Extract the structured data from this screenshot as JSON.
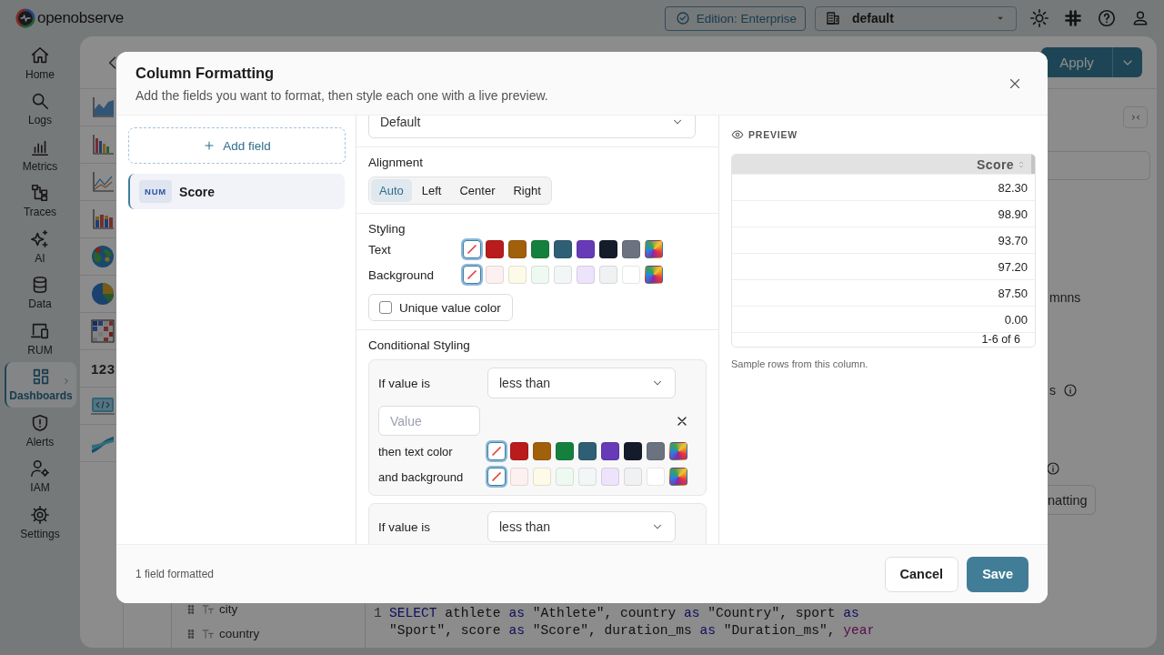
{
  "app": {
    "brand": "openobserve",
    "edition": "Edition: Enterprise",
    "org": "default",
    "nav": [
      {
        "label": "Home",
        "kind": "home",
        "selected": false
      },
      {
        "label": "Logs",
        "kind": "logs",
        "selected": false
      },
      {
        "label": "Metrics",
        "kind": "metrics",
        "selected": false
      },
      {
        "label": "Traces",
        "kind": "traces",
        "selected": false
      },
      {
        "label": "AI",
        "kind": "ai",
        "selected": false
      },
      {
        "label": "Data",
        "kind": "data",
        "selected": false
      },
      {
        "label": "RUM",
        "kind": "rum",
        "selected": false
      },
      {
        "label": "Dashboards",
        "kind": "dashboards",
        "selected": true
      },
      {
        "label": "Alerts",
        "kind": "alerts",
        "selected": false
      },
      {
        "label": "IAM",
        "kind": "iam",
        "selected": false
      },
      {
        "label": "Settings",
        "kind": "settings",
        "selected": false
      }
    ],
    "apply": "Apply",
    "chart_types": [
      {
        "kind": "area"
      },
      {
        "kind": "bar"
      },
      {
        "kind": "line"
      },
      {
        "kind": "stacked"
      },
      {
        "kind": "geomap"
      },
      {
        "kind": "pie"
      },
      {
        "kind": "heatmap"
      },
      {
        "kind": "metric",
        "label": "123"
      },
      {
        "kind": "html"
      },
      {
        "kind": "sankey"
      }
    ],
    "fields": [
      {
        "name": "city"
      },
      {
        "name": "country"
      }
    ],
    "query": {
      "line_number": "1",
      "lines": [
        [
          {
            "kind": "keyword",
            "t": "SELECT"
          },
          {
            "kind": "plain",
            "t": " athlete "
          },
          {
            "kind": "keyword",
            "t": "as"
          },
          {
            "kind": "plain",
            "t": " \"Athlete\", country "
          },
          {
            "kind": "keyword",
            "t": "as"
          },
          {
            "kind": "plain",
            "t": " \"Country\", sport "
          },
          {
            "kind": "keyword",
            "t": "as"
          }
        ],
        [
          {
            "kind": "plain",
            "t": "\"Sport\", score "
          },
          {
            "kind": "keyword",
            "t": "as"
          },
          {
            "kind": "plain",
            "t": " \"Score\", duration_ms "
          },
          {
            "kind": "keyword",
            "t": "as"
          },
          {
            "kind": "plain",
            "t": " \"Duration_ms\", "
          },
          {
            "kind": "function",
            "t": "year"
          }
        ]
      ]
    },
    "side_panel": {
      "label_1": "mnns",
      "label_2": "s",
      "button": "natting"
    }
  },
  "dialog": {
    "title": "Column Formatting",
    "subtitle": "Add the fields you want to format, then style each one with a live preview.",
    "add_field": "Add field",
    "fields": [
      {
        "type": "NUM",
        "name": "Score",
        "selected": true
      }
    ],
    "format_select": "Default",
    "alignment": {
      "label": "Alignment",
      "options": [
        {
          "label": "Auto",
          "selected": true
        },
        {
          "label": "Left",
          "selected": false
        },
        {
          "label": "Center",
          "selected": false
        },
        {
          "label": "Right",
          "selected": false
        }
      ]
    },
    "styling": {
      "label": "Styling",
      "rows": [
        {
          "label": "Text",
          "swatches": [
            {
              "kind": "none",
              "selected": true
            },
            {
              "kind": "solid",
              "color": "#b91c1c",
              "selected": false
            },
            {
              "kind": "solid",
              "color": "#a1600a",
              "selected": false
            },
            {
              "kind": "solid",
              "color": "#15803d",
              "selected": false
            },
            {
              "kind": "solid",
              "color": "#2f5f75",
              "selected": false
            },
            {
              "kind": "solid",
              "color": "#673ab7",
              "selected": false
            },
            {
              "kind": "solid",
              "color": "#141b2b",
              "selected": false
            },
            {
              "kind": "solid",
              "color": "#6b7280",
              "selected": false
            },
            {
              "kind": "custom",
              "selected": false
            }
          ]
        },
        {
          "label": "Background",
          "swatches": [
            {
              "kind": "none",
              "selected": true
            },
            {
              "kind": "solid",
              "color": "#fdf0f0",
              "selected": false
            },
            {
              "kind": "solid",
              "color": "#fdfae8",
              "selected": false
            },
            {
              "kind": "solid",
              "color": "#eefaf1",
              "selected": false
            },
            {
              "kind": "solid",
              "color": "#f2f6f6",
              "selected": false
            },
            {
              "kind": "solid",
              "color": "#ede4fb",
              "selected": false
            },
            {
              "kind": "solid",
              "color": "#f0f1f3",
              "selected": false
            },
            {
              "kind": "solid",
              "color": "#ffffff",
              "selected": false
            },
            {
              "kind": "custom",
              "selected": false
            }
          ]
        }
      ],
      "unique_value_color": {
        "label": "Unique value color",
        "checked": false
      }
    },
    "conditional": {
      "label": "Conditional Styling",
      "rules": [
        {
          "condition_label": "If value is",
          "operator": "less than",
          "value_placeholder": "Value",
          "color_rows": [
            {
              "label": "then text color",
              "swatches": [
                {
                  "kind": "none",
                  "selected": true
                },
                {
                  "kind": "solid",
                  "color": "#b91c1c",
                  "selected": false
                },
                {
                  "kind": "solid",
                  "color": "#a1600a",
                  "selected": false
                },
                {
                  "kind": "solid",
                  "color": "#15803d",
                  "selected": false
                },
                {
                  "kind": "solid",
                  "color": "#2f5f75",
                  "selected": false
                },
                {
                  "kind": "solid",
                  "color": "#673ab7",
                  "selected": false
                },
                {
                  "kind": "solid",
                  "color": "#141b2b",
                  "selected": false
                },
                {
                  "kind": "solid",
                  "color": "#6b7280",
                  "selected": false
                },
                {
                  "kind": "custom",
                  "selected": false
                }
              ]
            },
            {
              "label": "and background",
              "swatches": [
                {
                  "kind": "none",
                  "selected": true
                },
                {
                  "kind": "solid",
                  "color": "#fdf0f0",
                  "selected": false
                },
                {
                  "kind": "solid",
                  "color": "#fdfae8",
                  "selected": false
                },
                {
                  "kind": "solid",
                  "color": "#eefaf1",
                  "selected": false
                },
                {
                  "kind": "solid",
                  "color": "#f2f6f6",
                  "selected": false
                },
                {
                  "kind": "solid",
                  "color": "#ede4fb",
                  "selected": false
                },
                {
                  "kind": "solid",
                  "color": "#f0f1f3",
                  "selected": false
                },
                {
                  "kind": "solid",
                  "color": "#ffffff",
                  "selected": false
                },
                {
                  "kind": "custom",
                  "selected": false
                }
              ]
            }
          ]
        },
        {
          "condition_label": "If value is",
          "operator": "less than"
        }
      ]
    },
    "preview": {
      "label": "PREVIEW",
      "column": "Score",
      "rows": [
        "82.30",
        "98.90",
        "93.70",
        "97.20",
        "87.50",
        "0.00"
      ],
      "pagination": "1-6 of 6",
      "caption": "Sample rows from this column."
    },
    "footer": {
      "status": "1 field formatted",
      "cancel": "Cancel",
      "save": "Save"
    }
  }
}
